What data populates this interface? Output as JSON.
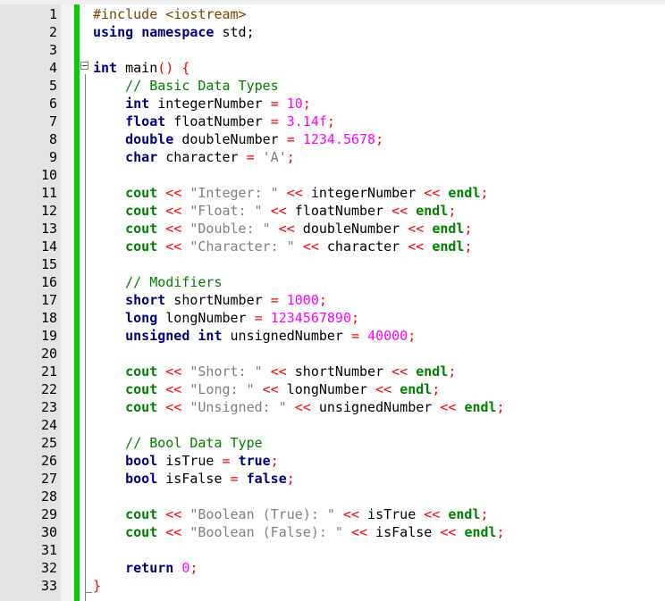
{
  "editor": {
    "lines": [
      {
        "num": "1",
        "tokens": [
          {
            "t": "#include <iostream>",
            "c": "p"
          }
        ]
      },
      {
        "num": "2",
        "tokens": [
          {
            "t": "using",
            "c": "k"
          },
          {
            "t": " ",
            "c": "i"
          },
          {
            "t": "namespace",
            "c": "k"
          },
          {
            "t": " std",
            "c": "i"
          },
          {
            "t": ";",
            "c": "i"
          }
        ]
      },
      {
        "num": "3",
        "tokens": []
      },
      {
        "num": "4",
        "tokens": [
          {
            "t": "int",
            "c": "k"
          },
          {
            "t": " main",
            "c": "i"
          },
          {
            "t": "()",
            "c": "o"
          },
          {
            "t": " {",
            "c": "o"
          }
        ]
      },
      {
        "num": "5",
        "tokens": [
          {
            "t": "    // Basic Data Types",
            "c": "c"
          }
        ]
      },
      {
        "num": "6",
        "tokens": [
          {
            "t": "    ",
            "c": "i"
          },
          {
            "t": "int",
            "c": "k"
          },
          {
            "t": " integerNumber ",
            "c": "i"
          },
          {
            "t": "=",
            "c": "o"
          },
          {
            "t": " ",
            "c": "i"
          },
          {
            "t": "10",
            "c": "n"
          },
          {
            "t": ";",
            "c": "o"
          }
        ]
      },
      {
        "num": "7",
        "tokens": [
          {
            "t": "    ",
            "c": "i"
          },
          {
            "t": "float",
            "c": "k"
          },
          {
            "t": " floatNumber ",
            "c": "i"
          },
          {
            "t": "=",
            "c": "o"
          },
          {
            "t": " ",
            "c": "i"
          },
          {
            "t": "3.14f",
            "c": "n"
          },
          {
            "t": ";",
            "c": "o"
          }
        ]
      },
      {
        "num": "8",
        "tokens": [
          {
            "t": "    ",
            "c": "i"
          },
          {
            "t": "double",
            "c": "k"
          },
          {
            "t": " doubleNumber ",
            "c": "i"
          },
          {
            "t": "=",
            "c": "o"
          },
          {
            "t": " ",
            "c": "i"
          },
          {
            "t": "1234.5678",
            "c": "n"
          },
          {
            "t": ";",
            "c": "o"
          }
        ]
      },
      {
        "num": "9",
        "tokens": [
          {
            "t": "    ",
            "c": "i"
          },
          {
            "t": "char",
            "c": "k"
          },
          {
            "t": " character ",
            "c": "i"
          },
          {
            "t": "=",
            "c": "o"
          },
          {
            "t": " ",
            "c": "i"
          },
          {
            "t": "'A'",
            "c": "s"
          },
          {
            "t": ";",
            "c": "o"
          }
        ]
      },
      {
        "num": "10",
        "tokens": []
      },
      {
        "num": "11",
        "tokens": [
          {
            "t": "    ",
            "c": "i"
          },
          {
            "t": "cout",
            "c": "e"
          },
          {
            "t": " ",
            "c": "i"
          },
          {
            "t": "<<",
            "c": "o"
          },
          {
            "t": " ",
            "c": "i"
          },
          {
            "t": "\"Integer: \"",
            "c": "s"
          },
          {
            "t": " ",
            "c": "i"
          },
          {
            "t": "<<",
            "c": "o"
          },
          {
            "t": " integerNumber ",
            "c": "i"
          },
          {
            "t": "<<",
            "c": "o"
          },
          {
            "t": " ",
            "c": "i"
          },
          {
            "t": "endl",
            "c": "e"
          },
          {
            "t": ";",
            "c": "o"
          }
        ]
      },
      {
        "num": "12",
        "tokens": [
          {
            "t": "    ",
            "c": "i"
          },
          {
            "t": "cout",
            "c": "e"
          },
          {
            "t": " ",
            "c": "i"
          },
          {
            "t": "<<",
            "c": "o"
          },
          {
            "t": " ",
            "c": "i"
          },
          {
            "t": "\"Float: \"",
            "c": "s"
          },
          {
            "t": " ",
            "c": "i"
          },
          {
            "t": "<<",
            "c": "o"
          },
          {
            "t": " floatNumber ",
            "c": "i"
          },
          {
            "t": "<<",
            "c": "o"
          },
          {
            "t": " ",
            "c": "i"
          },
          {
            "t": "endl",
            "c": "e"
          },
          {
            "t": ";",
            "c": "o"
          }
        ]
      },
      {
        "num": "13",
        "tokens": [
          {
            "t": "    ",
            "c": "i"
          },
          {
            "t": "cout",
            "c": "e"
          },
          {
            "t": " ",
            "c": "i"
          },
          {
            "t": "<<",
            "c": "o"
          },
          {
            "t": " ",
            "c": "i"
          },
          {
            "t": "\"Double: \"",
            "c": "s"
          },
          {
            "t": " ",
            "c": "i"
          },
          {
            "t": "<<",
            "c": "o"
          },
          {
            "t": " doubleNumber ",
            "c": "i"
          },
          {
            "t": "<<",
            "c": "o"
          },
          {
            "t": " ",
            "c": "i"
          },
          {
            "t": "endl",
            "c": "e"
          },
          {
            "t": ";",
            "c": "o"
          }
        ]
      },
      {
        "num": "14",
        "tokens": [
          {
            "t": "    ",
            "c": "i"
          },
          {
            "t": "cout",
            "c": "e"
          },
          {
            "t": " ",
            "c": "i"
          },
          {
            "t": "<<",
            "c": "o"
          },
          {
            "t": " ",
            "c": "i"
          },
          {
            "t": "\"Character: \"",
            "c": "s"
          },
          {
            "t": " ",
            "c": "i"
          },
          {
            "t": "<<",
            "c": "o"
          },
          {
            "t": " character ",
            "c": "i"
          },
          {
            "t": "<<",
            "c": "o"
          },
          {
            "t": " ",
            "c": "i"
          },
          {
            "t": "endl",
            "c": "e"
          },
          {
            "t": ";",
            "c": "o"
          }
        ]
      },
      {
        "num": "15",
        "tokens": []
      },
      {
        "num": "16",
        "tokens": [
          {
            "t": "    // Modifiers",
            "c": "c"
          }
        ]
      },
      {
        "num": "17",
        "tokens": [
          {
            "t": "    ",
            "c": "i"
          },
          {
            "t": "short",
            "c": "k"
          },
          {
            "t": " shortNumber ",
            "c": "i"
          },
          {
            "t": "=",
            "c": "o"
          },
          {
            "t": " ",
            "c": "i"
          },
          {
            "t": "1000",
            "c": "n"
          },
          {
            "t": ";",
            "c": "o"
          }
        ]
      },
      {
        "num": "18",
        "tokens": [
          {
            "t": "    ",
            "c": "i"
          },
          {
            "t": "long",
            "c": "k"
          },
          {
            "t": " longNumber ",
            "c": "i"
          },
          {
            "t": "=",
            "c": "o"
          },
          {
            "t": " ",
            "c": "i"
          },
          {
            "t": "1234567890",
            "c": "n"
          },
          {
            "t": ";",
            "c": "o"
          }
        ]
      },
      {
        "num": "19",
        "tokens": [
          {
            "t": "    ",
            "c": "i"
          },
          {
            "t": "unsigned",
            "c": "k"
          },
          {
            "t": " ",
            "c": "i"
          },
          {
            "t": "int",
            "c": "k"
          },
          {
            "t": " unsignedNumber ",
            "c": "i"
          },
          {
            "t": "=",
            "c": "o"
          },
          {
            "t": " ",
            "c": "i"
          },
          {
            "t": "40000",
            "c": "n"
          },
          {
            "t": ";",
            "c": "o"
          }
        ]
      },
      {
        "num": "20",
        "tokens": []
      },
      {
        "num": "21",
        "tokens": [
          {
            "t": "    ",
            "c": "i"
          },
          {
            "t": "cout",
            "c": "e"
          },
          {
            "t": " ",
            "c": "i"
          },
          {
            "t": "<<",
            "c": "o"
          },
          {
            "t": " ",
            "c": "i"
          },
          {
            "t": "\"Short: \"",
            "c": "s"
          },
          {
            "t": " ",
            "c": "i"
          },
          {
            "t": "<<",
            "c": "o"
          },
          {
            "t": " shortNumber ",
            "c": "i"
          },
          {
            "t": "<<",
            "c": "o"
          },
          {
            "t": " ",
            "c": "i"
          },
          {
            "t": "endl",
            "c": "e"
          },
          {
            "t": ";",
            "c": "o"
          }
        ]
      },
      {
        "num": "22",
        "tokens": [
          {
            "t": "    ",
            "c": "i"
          },
          {
            "t": "cout",
            "c": "e"
          },
          {
            "t": " ",
            "c": "i"
          },
          {
            "t": "<<",
            "c": "o"
          },
          {
            "t": " ",
            "c": "i"
          },
          {
            "t": "\"Long: \"",
            "c": "s"
          },
          {
            "t": " ",
            "c": "i"
          },
          {
            "t": "<<",
            "c": "o"
          },
          {
            "t": " longNumber ",
            "c": "i"
          },
          {
            "t": "<<",
            "c": "o"
          },
          {
            "t": " ",
            "c": "i"
          },
          {
            "t": "endl",
            "c": "e"
          },
          {
            "t": ";",
            "c": "o"
          }
        ]
      },
      {
        "num": "23",
        "tokens": [
          {
            "t": "    ",
            "c": "i"
          },
          {
            "t": "cout",
            "c": "e"
          },
          {
            "t": " ",
            "c": "i"
          },
          {
            "t": "<<",
            "c": "o"
          },
          {
            "t": " ",
            "c": "i"
          },
          {
            "t": "\"Unsigned: \"",
            "c": "s"
          },
          {
            "t": " ",
            "c": "i"
          },
          {
            "t": "<<",
            "c": "o"
          },
          {
            "t": " unsignedNumber ",
            "c": "i"
          },
          {
            "t": "<<",
            "c": "o"
          },
          {
            "t": " ",
            "c": "i"
          },
          {
            "t": "endl",
            "c": "e"
          },
          {
            "t": ";",
            "c": "o"
          }
        ]
      },
      {
        "num": "24",
        "tokens": []
      },
      {
        "num": "25",
        "tokens": [
          {
            "t": "    // Bool Data Type",
            "c": "c"
          }
        ]
      },
      {
        "num": "26",
        "tokens": [
          {
            "t": "    ",
            "c": "i"
          },
          {
            "t": "bool",
            "c": "k"
          },
          {
            "t": " isTrue ",
            "c": "i"
          },
          {
            "t": "=",
            "c": "o"
          },
          {
            "t": " ",
            "c": "i"
          },
          {
            "t": "true",
            "c": "k"
          },
          {
            "t": ";",
            "c": "o"
          }
        ]
      },
      {
        "num": "27",
        "tokens": [
          {
            "t": "    ",
            "c": "i"
          },
          {
            "t": "bool",
            "c": "k"
          },
          {
            "t": " isFalse ",
            "c": "i"
          },
          {
            "t": "=",
            "c": "o"
          },
          {
            "t": " ",
            "c": "i"
          },
          {
            "t": "false",
            "c": "k"
          },
          {
            "t": ";",
            "c": "o"
          }
        ]
      },
      {
        "num": "28",
        "tokens": []
      },
      {
        "num": "29",
        "tokens": [
          {
            "t": "    ",
            "c": "i"
          },
          {
            "t": "cout",
            "c": "e"
          },
          {
            "t": " ",
            "c": "i"
          },
          {
            "t": "<<",
            "c": "o"
          },
          {
            "t": " ",
            "c": "i"
          },
          {
            "t": "\"Boolean (True): \"",
            "c": "s"
          },
          {
            "t": " ",
            "c": "i"
          },
          {
            "t": "<<",
            "c": "o"
          },
          {
            "t": " isTrue ",
            "c": "i"
          },
          {
            "t": "<<",
            "c": "o"
          },
          {
            "t": " ",
            "c": "i"
          },
          {
            "t": "endl",
            "c": "e"
          },
          {
            "t": ";",
            "c": "o"
          }
        ]
      },
      {
        "num": "30",
        "tokens": [
          {
            "t": "    ",
            "c": "i"
          },
          {
            "t": "cout",
            "c": "e"
          },
          {
            "t": " ",
            "c": "i"
          },
          {
            "t": "<<",
            "c": "o"
          },
          {
            "t": " ",
            "c": "i"
          },
          {
            "t": "\"Boolean (False): \"",
            "c": "s"
          },
          {
            "t": " ",
            "c": "i"
          },
          {
            "t": "<<",
            "c": "o"
          },
          {
            "t": " isFalse ",
            "c": "i"
          },
          {
            "t": "<<",
            "c": "o"
          },
          {
            "t": " ",
            "c": "i"
          },
          {
            "t": "endl",
            "c": "e"
          },
          {
            "t": ";",
            "c": "o"
          }
        ]
      },
      {
        "num": "31",
        "tokens": []
      },
      {
        "num": "32",
        "tokens": [
          {
            "t": "    ",
            "c": "i"
          },
          {
            "t": "return",
            "c": "k"
          },
          {
            "t": " ",
            "c": "i"
          },
          {
            "t": "0",
            "c": "n"
          },
          {
            "t": ";",
            "c": "o"
          }
        ]
      },
      {
        "num": "33",
        "tokens": [
          {
            "t": "}",
            "c": "o"
          }
        ]
      }
    ]
  },
  "colors": {
    "keyword": "#000080",
    "preprocessor": "#804000",
    "number": "#ff00ff",
    "string": "#808080",
    "comment": "#008000",
    "operator": "#ff0000",
    "stream": "#008000",
    "change_bar": "#00d000",
    "gutter": "#e4e4e4"
  }
}
